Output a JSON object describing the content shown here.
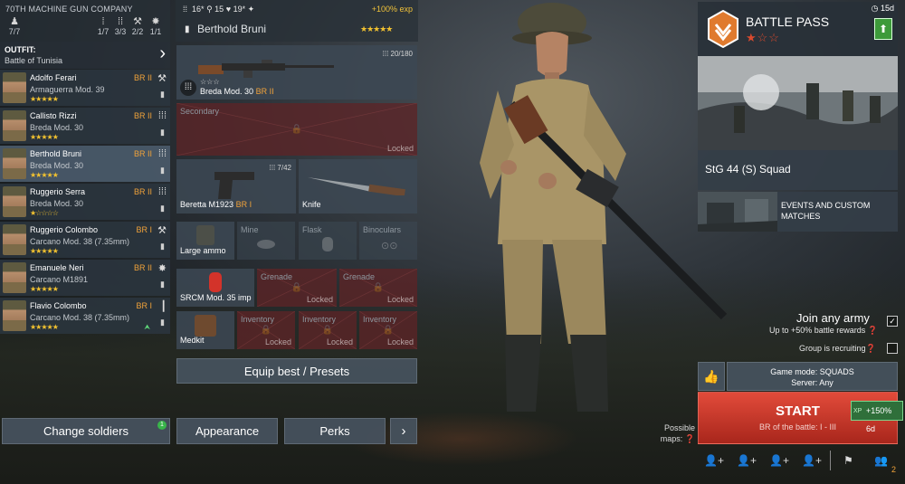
{
  "company": {
    "title": "70TH MACHINE GUN COMPANY",
    "counts": [
      {
        "icon": "person-icon",
        "value": "7/7"
      },
      {
        "icon": "machine-gunner-icon",
        "value": "1/7"
      },
      {
        "icon": "rifle-ammo-icon",
        "value": "3/3"
      },
      {
        "icon": "engineer-icon",
        "value": "2/2"
      },
      {
        "icon": "explosion-icon",
        "value": "1/1"
      }
    ]
  },
  "outfit": {
    "label": "OUTFIT:",
    "value": "Battle of Tunisia"
  },
  "soldiers": [
    {
      "name": "Adolfo Ferari",
      "weapon": "Armaguerra Mod. 39",
      "br": "BR II",
      "stars": "★★★★★",
      "role": "engineer-icon"
    },
    {
      "name": "Callisto Rizzi",
      "weapon": "Breda Mod. 30",
      "br": "BR II",
      "stars": "★★★★★",
      "role": "machine-gunner-icon"
    },
    {
      "name": "Berthold Bruni",
      "weapon": "Breda Mod. 30",
      "br": "BR II",
      "stars": "★★★★★",
      "role": "machine-gunner-icon"
    },
    {
      "name": "Ruggerio Serra",
      "weapon": "Breda Mod. 30",
      "br": "BR II",
      "stars": "★☆☆☆☆",
      "role": "machine-gunner-icon"
    },
    {
      "name": "Ruggerio Colombo",
      "weapon": "Carcano Mod. 38 (7.35mm)",
      "br": "BR I",
      "stars": "★★★★★",
      "role": "engineer-icon"
    },
    {
      "name": "Emanuele Neri",
      "weapon": "Carcano M1891",
      "br": "BR II",
      "stars": "★★★★★",
      "role": "explosion-icon"
    },
    {
      "name": "Flavio Colombo",
      "weapon": "Carcano Mod. 38 (7.35mm)",
      "br": "BR I",
      "stars": "★★★★★",
      "role": "rifleman-icon"
    }
  ],
  "loadout": {
    "stats": {
      "a": "16*",
      "b": "15",
      "c": "19*"
    },
    "exp": "+100% exp",
    "name": "Berthold Bruni",
    "stars": "★★★★★",
    "primary": {
      "name": "Breda Mod. 30",
      "br": "BR II",
      "ammo": "20/180",
      "stars": "☆☆☆"
    },
    "secondary": {
      "label": "Secondary",
      "locked": "Locked"
    },
    "pistol": {
      "name": "Beretta M1923",
      "br": "BR I",
      "ammo": "7/42"
    },
    "melee": {
      "name": "Knife"
    },
    "items": [
      {
        "label": "Large ammo"
      },
      {
        "label": "Mine"
      },
      {
        "label": "Flask"
      },
      {
        "label": "Binoculars"
      }
    ],
    "grenades": [
      {
        "label": "SRCM Mod. 35 imp"
      },
      {
        "label": "Grenade",
        "locked": "Locked"
      },
      {
        "label": "Grenade",
        "locked": "Locked"
      }
    ],
    "inventory": [
      {
        "label": "Medkit"
      },
      {
        "label": "Inventory",
        "locked": "Locked"
      },
      {
        "label": "Inventory",
        "locked": "Locked"
      },
      {
        "label": "Inventory",
        "locked": "Locked"
      }
    ],
    "equip_label": "Equip best / Presets"
  },
  "bottom_buttons": {
    "change": "Change soldiers",
    "change_badge": "1",
    "appearance": "Appearance",
    "perks": "Perks",
    "next": "›"
  },
  "battle_pass": {
    "title": "BATTLE PASS",
    "stars": "★☆☆",
    "timer": "15d"
  },
  "squad_offer": "StG 44 (S) Squad",
  "events": "EVENTS AND CUSTOM MATCHES",
  "join": {
    "label": "Join any army",
    "sub": "Up to +50% battle rewards",
    "group": "Group is recruiting"
  },
  "game_mode": {
    "mode": "Game mode: SQUADS",
    "server": "Server: Any"
  },
  "start": {
    "label": "START",
    "br": "BR of the battle: I - III",
    "boost": "+150% 6d",
    "xp": "XP"
  },
  "possible_maps": {
    "line1": "Possible",
    "line2": "maps:"
  },
  "friends_count": "2"
}
